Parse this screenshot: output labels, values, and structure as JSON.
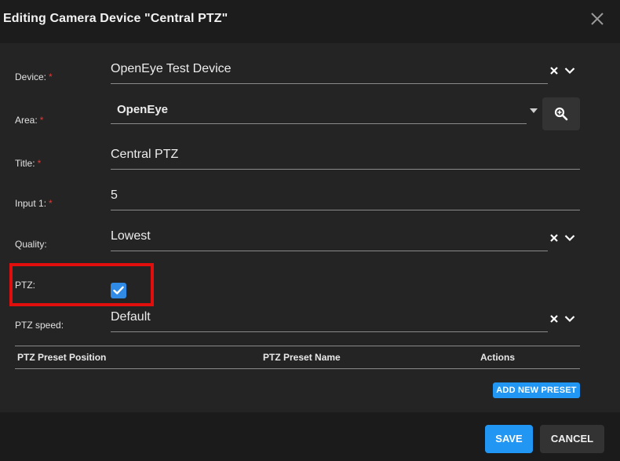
{
  "dialog": {
    "title": "Editing Camera Device \"Central PTZ\""
  },
  "form": {
    "device": {
      "label": "Device:",
      "value": "OpenEye Test Device",
      "required": "*"
    },
    "area": {
      "label": "Area:",
      "value": "OpenEye",
      "required": "*"
    },
    "title": {
      "label": "Title:",
      "value": "Central PTZ",
      "required": "*"
    },
    "input1": {
      "label": "Input 1:",
      "value": "5",
      "required": "*"
    },
    "quality": {
      "label": "Quality:",
      "value": "Lowest"
    },
    "ptz": {
      "label": "PTZ:",
      "checked": true
    },
    "ptz_speed": {
      "label": "PTZ speed:",
      "value": "Default"
    }
  },
  "presets_table": {
    "columns": [
      "PTZ Preset Position",
      "PTZ Preset Name",
      "Actions"
    ],
    "add_label": "ADD NEW PRESET"
  },
  "footer": {
    "save_label": "SAVE",
    "cancel_label": "CANCEL"
  },
  "colors": {
    "accent": "#2196f3",
    "required": "#e53935",
    "highlight": "#e10e0e"
  }
}
